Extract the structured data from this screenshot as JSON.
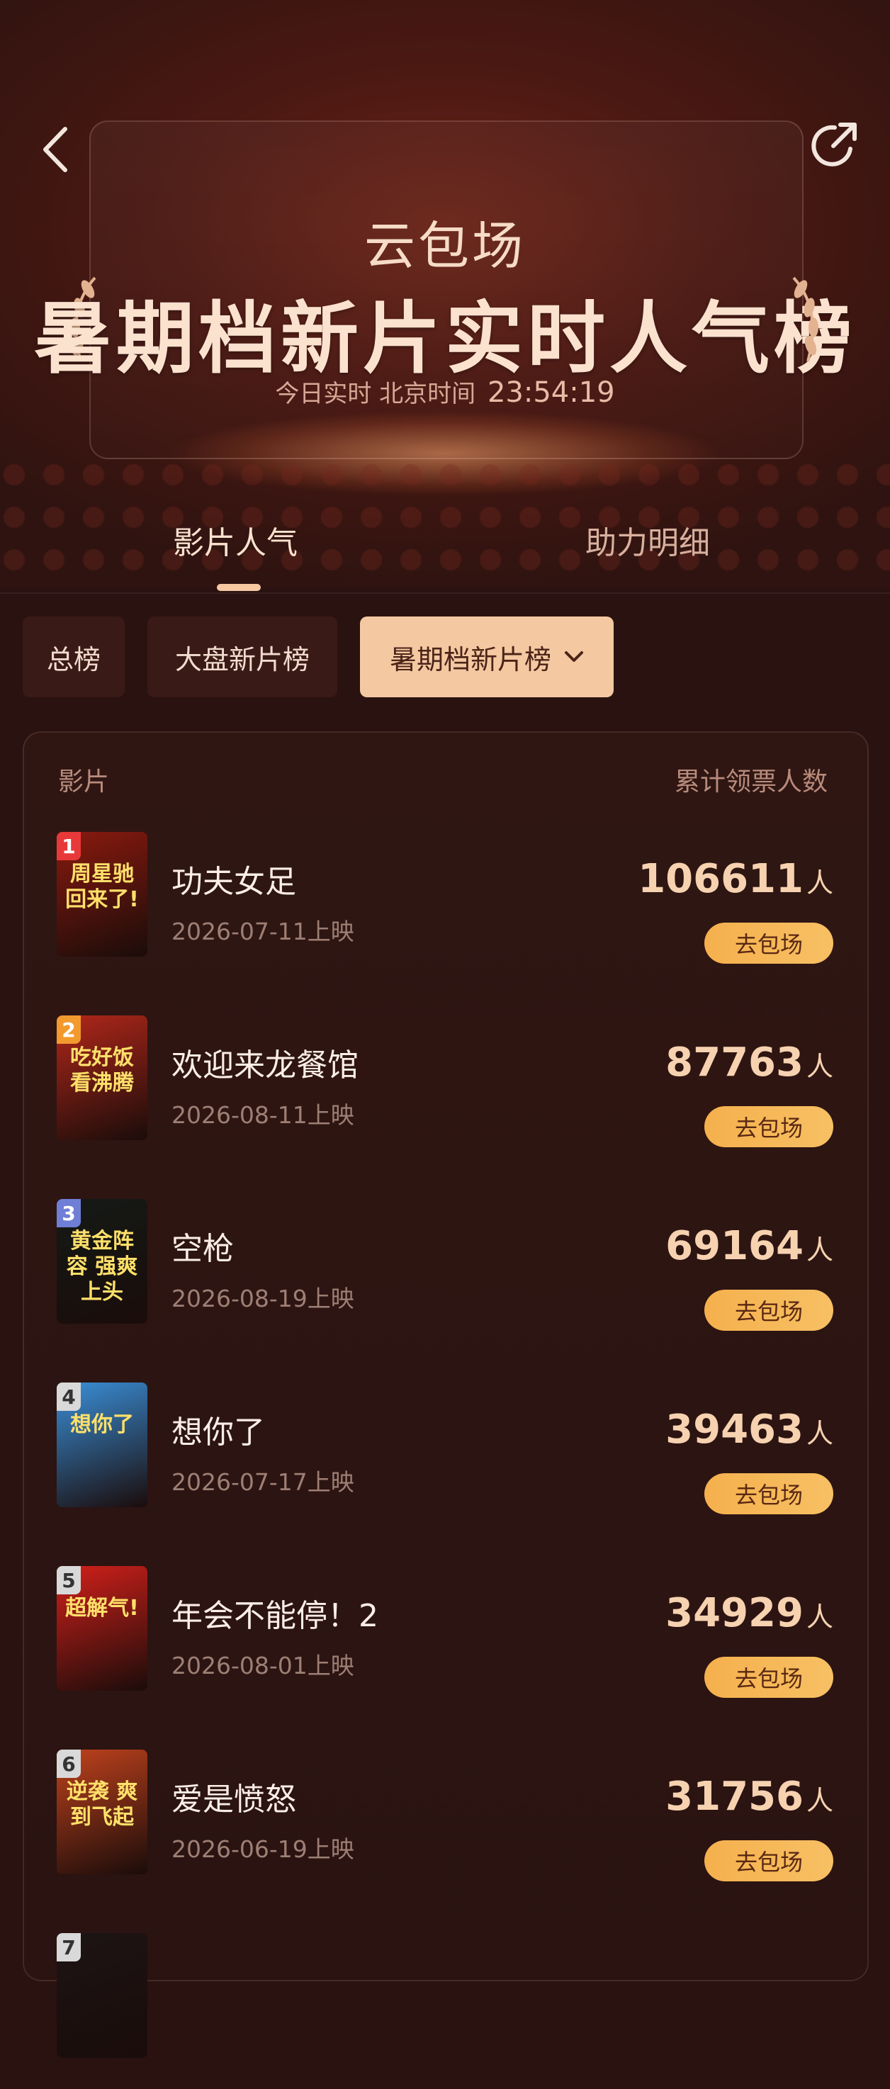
{
  "header": {
    "subtitle": "云包场",
    "title": "暑期档新片实时人气榜",
    "time_label": "今日实时 北京时间",
    "time_value": "23:54:19"
  },
  "tabs": [
    {
      "label": "影片人气",
      "active": true
    },
    {
      "label": "助力明细",
      "active": false
    }
  ],
  "filters": [
    {
      "label": "总榜",
      "selected": false
    },
    {
      "label": "大盘新片榜",
      "selected": false
    },
    {
      "label": "暑期档新片榜",
      "selected": true
    }
  ],
  "list": {
    "col_left": "影片",
    "col_right": "累计领票人数",
    "unit": "人",
    "action_label": "去包场",
    "items": [
      {
        "rank": "1",
        "title": "功夫女足",
        "date": "2026-07-11上映",
        "count": "106611",
        "poster_text": "周星驰回来了!",
        "poster_color": "#8a1a0e",
        "rank_color": "#e8393a"
      },
      {
        "rank": "2",
        "title": "欢迎来龙餐馆",
        "date": "2026-08-11上映",
        "count": "87763",
        "poster_text": "吃好饭 看沸腾",
        "poster_color": "#b1271a",
        "rank_color": "#f29a2e"
      },
      {
        "rank": "3",
        "title": "空枪",
        "date": "2026-08-19上映",
        "count": "69164",
        "poster_text": "黄金阵容 强爽上头",
        "poster_color": "#141a16",
        "rank_color": "#6f7fd6"
      },
      {
        "rank": "4",
        "title": "想你了",
        "date": "2026-07-17上映",
        "count": "39463",
        "poster_text": "想你了",
        "poster_color": "#3a8fd8",
        "rank_color": "#d9d9d9"
      },
      {
        "rank": "5",
        "title": "年会不能停！2",
        "date": "2026-08-01上映",
        "count": "34929",
        "poster_text": "超解气!",
        "poster_color": "#d2201a",
        "rank_color": "#d9d9d9"
      },
      {
        "rank": "6",
        "title": "爱是愤怒",
        "date": "2026-06-19上映",
        "count": "31756",
        "poster_text": "逆袭 爽到飞起",
        "poster_color": "#c0421d",
        "rank_color": "#d9d9d9"
      },
      {
        "rank": "7",
        "title": "",
        "date": "",
        "count": "",
        "poster_text": "",
        "poster_color": "#1c1414",
        "rank_color": "#d9d9d9"
      }
    ]
  }
}
